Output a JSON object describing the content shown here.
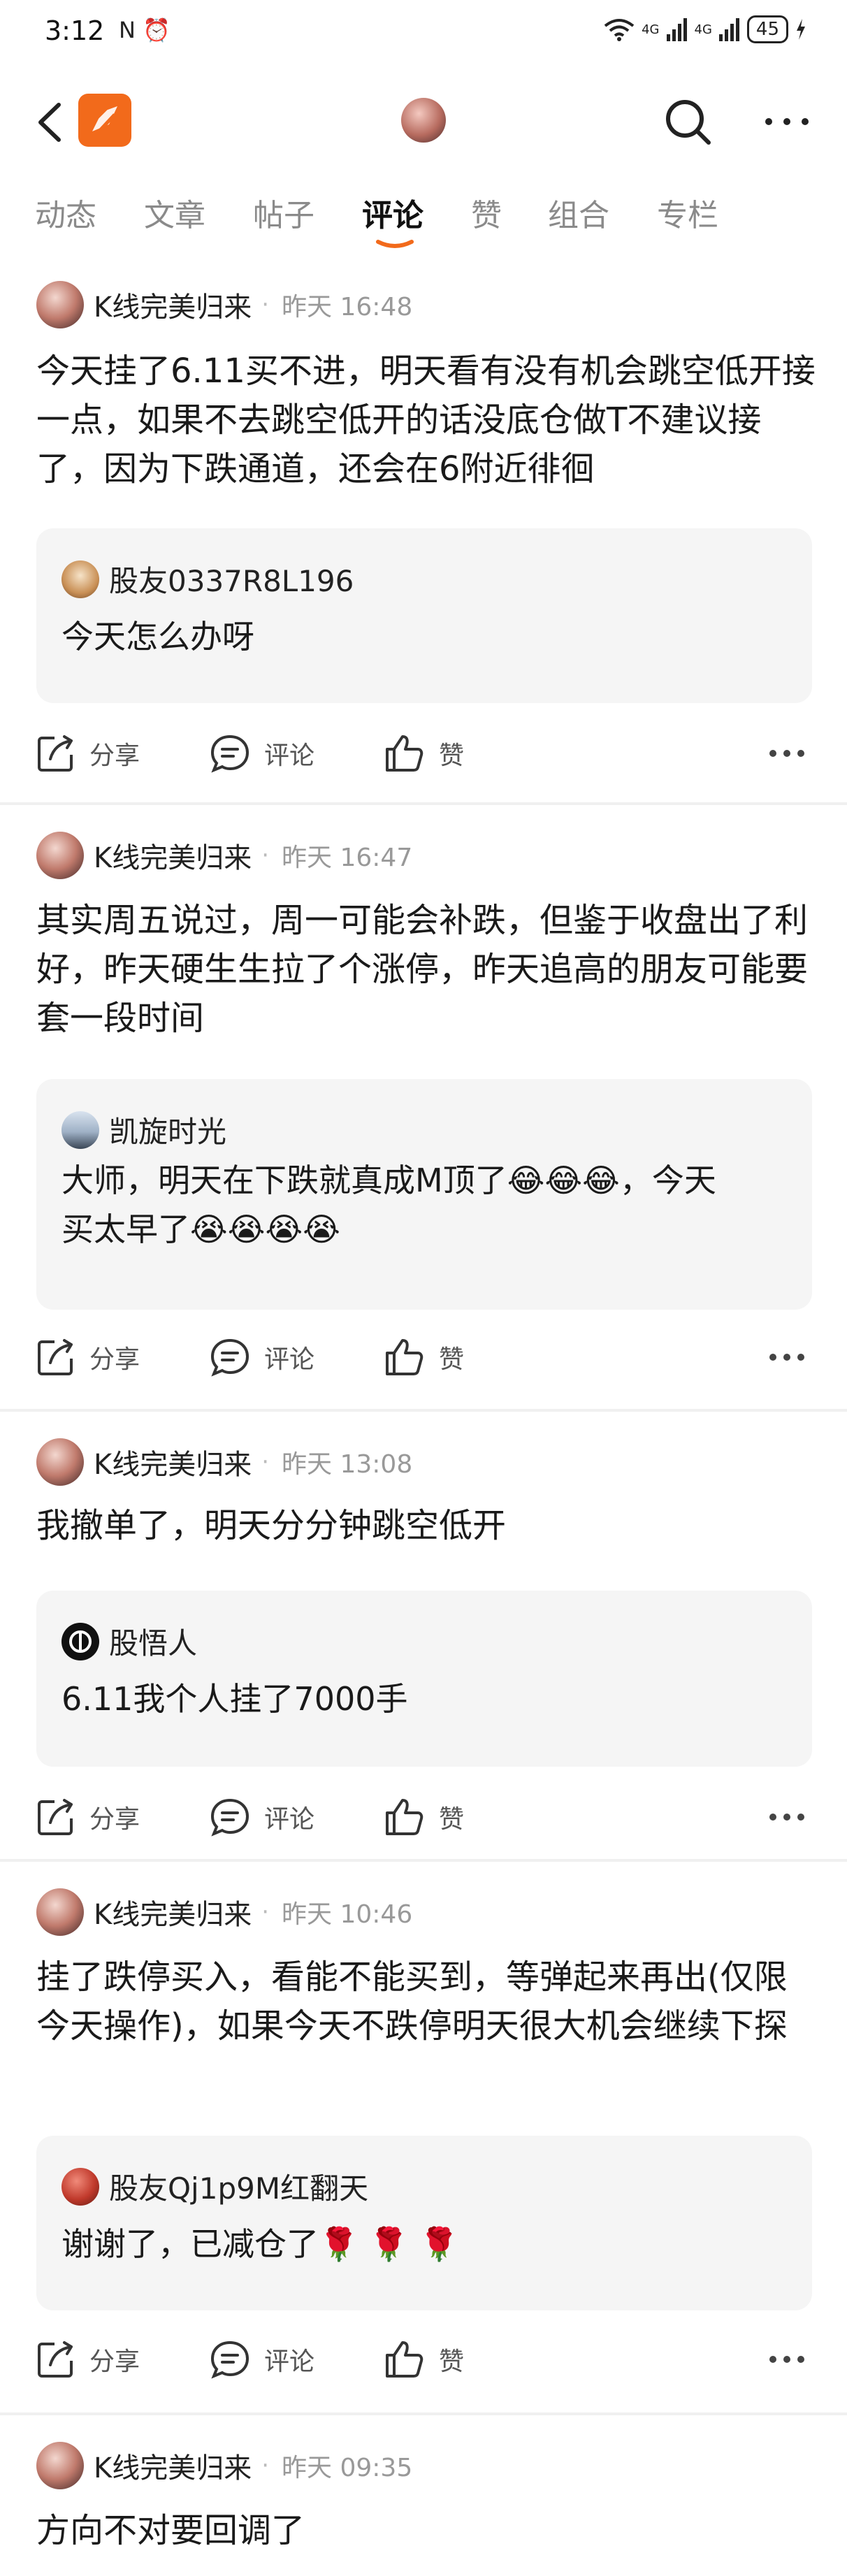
{
  "status_bar": {
    "time": "3:12",
    "indicators": "N ⏰",
    "network_1": "4G",
    "network_2": "4G",
    "battery": "45"
  },
  "nav": {
    "icons": [
      "back-icon",
      "app-logo",
      "profile-avatar",
      "search-icon",
      "more-icon"
    ],
    "accent_color": "#f26a1b"
  },
  "tabs": [
    {
      "label": "动态"
    },
    {
      "label": "文章"
    },
    {
      "label": "帖子"
    },
    {
      "label": "评论",
      "active": true
    },
    {
      "label": "赞"
    },
    {
      "label": "组合"
    },
    {
      "label": "专栏"
    }
  ],
  "actions": {
    "share": "分享",
    "comment": "评论",
    "like": "赞"
  },
  "threads": [
    {
      "author": "K线完美归来",
      "time": "昨天 16:48",
      "content": "今天挂了6.11买不进，明天看有没有机会跳空低开接一点，如果不去跳空低开的话没底仓做T不建议接了，因为下跌通道，还会在6附近徘徊",
      "reply_user": "股友0337R8L196",
      "reply_text": "今天怎么办呀"
    },
    {
      "author": "K线完美归来",
      "time": "昨天 16:47",
      "content": "其实周五说过，周一可能会补跌，但鉴于收盘出了利好，昨天硬生生拉了个涨停，昨天追高的朋友可能要套一段时间",
      "reply_user": "凯旋时光",
      "reply_text_1": "大师，明天在下跌就真成M顶了😂😂😂，今天",
      "reply_text_2": "买太早了😭😭😭😭"
    },
    {
      "author": "K线完美归来",
      "time": "昨天 13:08",
      "content": "我撤单了，明天分分钟跳空低开",
      "reply_user": "股悟人",
      "reply_text": "6.11我个人挂了7000手"
    },
    {
      "author": "K线完美归来",
      "time": "昨天 10:46",
      "content": "挂了跌停买入，看能不能买到，等弹起来再出(仅限今天操作)，如果今天不跌停明天很大机会继续下探",
      "reply_user": "股友Qj1p9M红翻天",
      "reply_text": "谢谢了，已减仓了🌹 🌹 🌹"
    },
    {
      "author": "K线完美归来",
      "time": "昨天 09:35",
      "content": "方向不对要回调了"
    }
  ]
}
